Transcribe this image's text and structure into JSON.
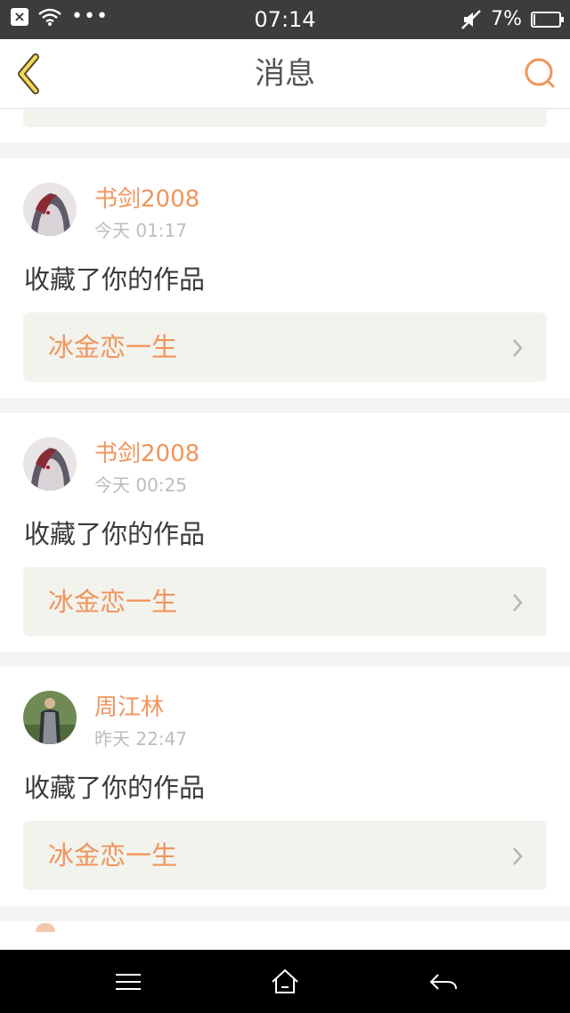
{
  "status_bar": {
    "time": "07:14",
    "battery": "7%",
    "battery_level": 0.07,
    "left_icons": [
      "close-box-icon",
      "wifi-icon",
      "more-dots-icon"
    ],
    "right_icons": [
      "mute-icon",
      "battery-icon"
    ]
  },
  "nav": {
    "title": "消息",
    "back_icon": "chevron-left-icon",
    "search_icon": "search-icon",
    "accent_color": "#f0955c"
  },
  "messages": [
    {
      "name": "书剑2008",
      "time": "今天 01:17",
      "action": "收藏了你的作品",
      "work_title": "冰金恋一生"
    },
    {
      "name": "书剑2008",
      "time": "今天 00:25",
      "action": "收藏了你的作品",
      "work_title": "冰金恋一生"
    },
    {
      "name": "周江林",
      "time": "昨天 22:47",
      "action": "收藏了你的作品",
      "work_title": "冰金恋一生"
    }
  ],
  "system_nav": {
    "icons": [
      "menu-icon",
      "home-icon",
      "back-arrow-icon"
    ]
  }
}
